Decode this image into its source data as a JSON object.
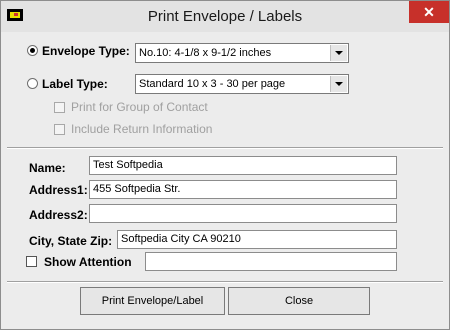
{
  "window": {
    "title": "Print Envelope / Labels",
    "close_glyph": "✕"
  },
  "envelope": {
    "label": "Envelope Type:",
    "value": "No.10: 4-1/8 x 9-1/2 inches",
    "selected": true
  },
  "label_type": {
    "label": "Label Type:",
    "value": "Standard 10 x 3 - 30 per page",
    "selected": false
  },
  "options": {
    "print_group": "Print for Group of Contact",
    "include_return": "Include Return Information"
  },
  "form": {
    "name_label": "Name:",
    "name_value": "Test Softpedia",
    "address1_label": "Address1:",
    "address1_value": "455 Softpedia Str.",
    "address2_label": "Address2:",
    "address2_value": "",
    "city_label": "City, State Zip:",
    "city_value": "Softpedia City CA 90210",
    "attention_label": "Show Attention",
    "attention_value": ""
  },
  "buttons": {
    "print": "Print Envelope/Label",
    "close": "Close"
  },
  "colors": {
    "close_button": "#c7302a",
    "background": "#ececec"
  },
  "icons": {
    "app": "envelope-app-icon",
    "close": "close-icon",
    "dropdown": "chevron-down-icon"
  }
}
